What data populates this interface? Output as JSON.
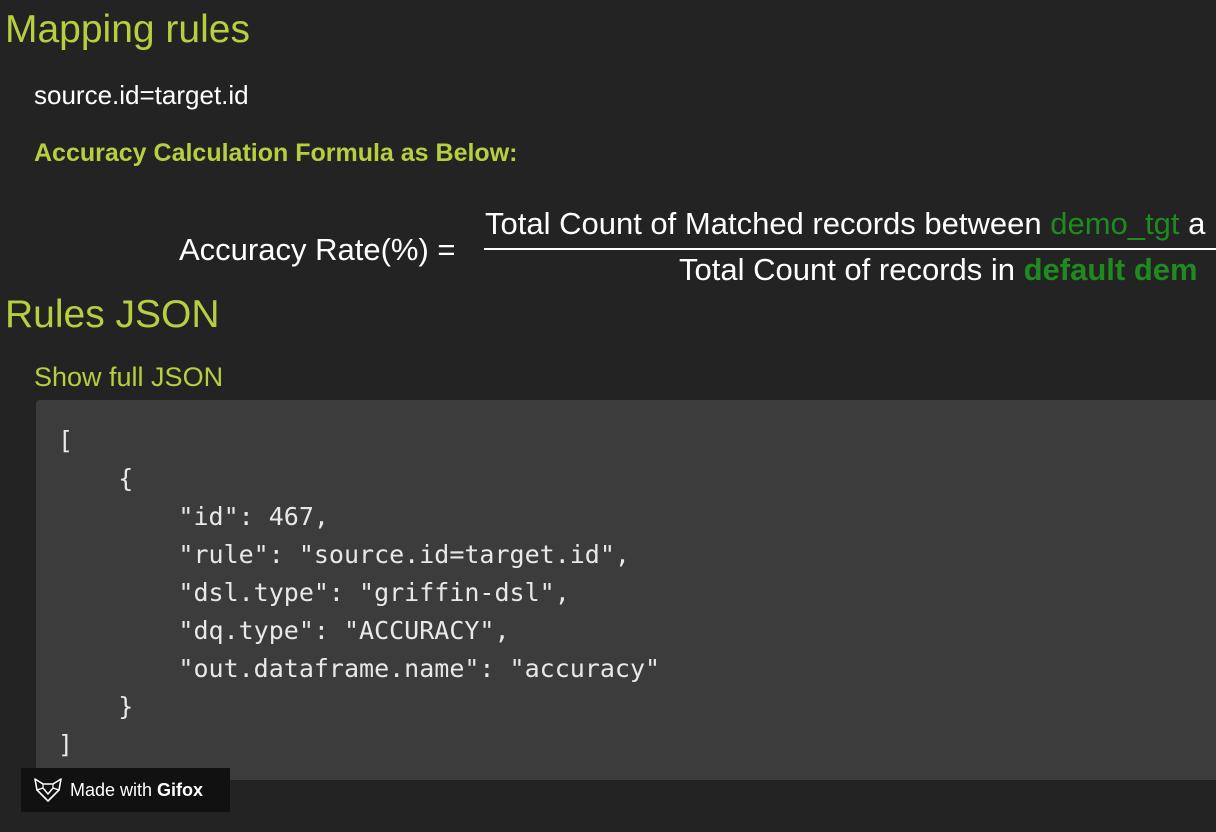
{
  "mapping": {
    "title": "Mapping rules",
    "rule": "source.id=target.id",
    "formula_label": "Accuracy Calculation Formula as Below:"
  },
  "formula": {
    "lhs": "Accuracy Rate(%) =",
    "numerator_prefix": "Total Count of Matched records between ",
    "numerator_table": "demo_tgt",
    "numerator_suffix": " a",
    "denominator_prefix": "Total Count of records in ",
    "denominator_db": "default",
    "denominator_table": "dem"
  },
  "rules_json": {
    "title": "Rules JSON",
    "toggle_label": "Show full JSON",
    "lines": [
      "[",
      "    {",
      "        \"id\": 467,",
      "        \"rule\": \"source.id=target.id\",",
      "        \"dsl.type\": \"griffin-dsl\",",
      "        \"dq.type\": \"ACCURACY\",",
      "        \"out.dataframe.name\": \"accuracy\"",
      "    }",
      "]"
    ]
  },
  "watermark": {
    "prefix": "Made with ",
    "brand": "Gifox",
    "icon": "fox-icon"
  },
  "colors": {
    "background": "#232323",
    "accent": "#b5cf3e",
    "table_name": "#1f8a1f",
    "code_background": "#3c3c3c"
  }
}
